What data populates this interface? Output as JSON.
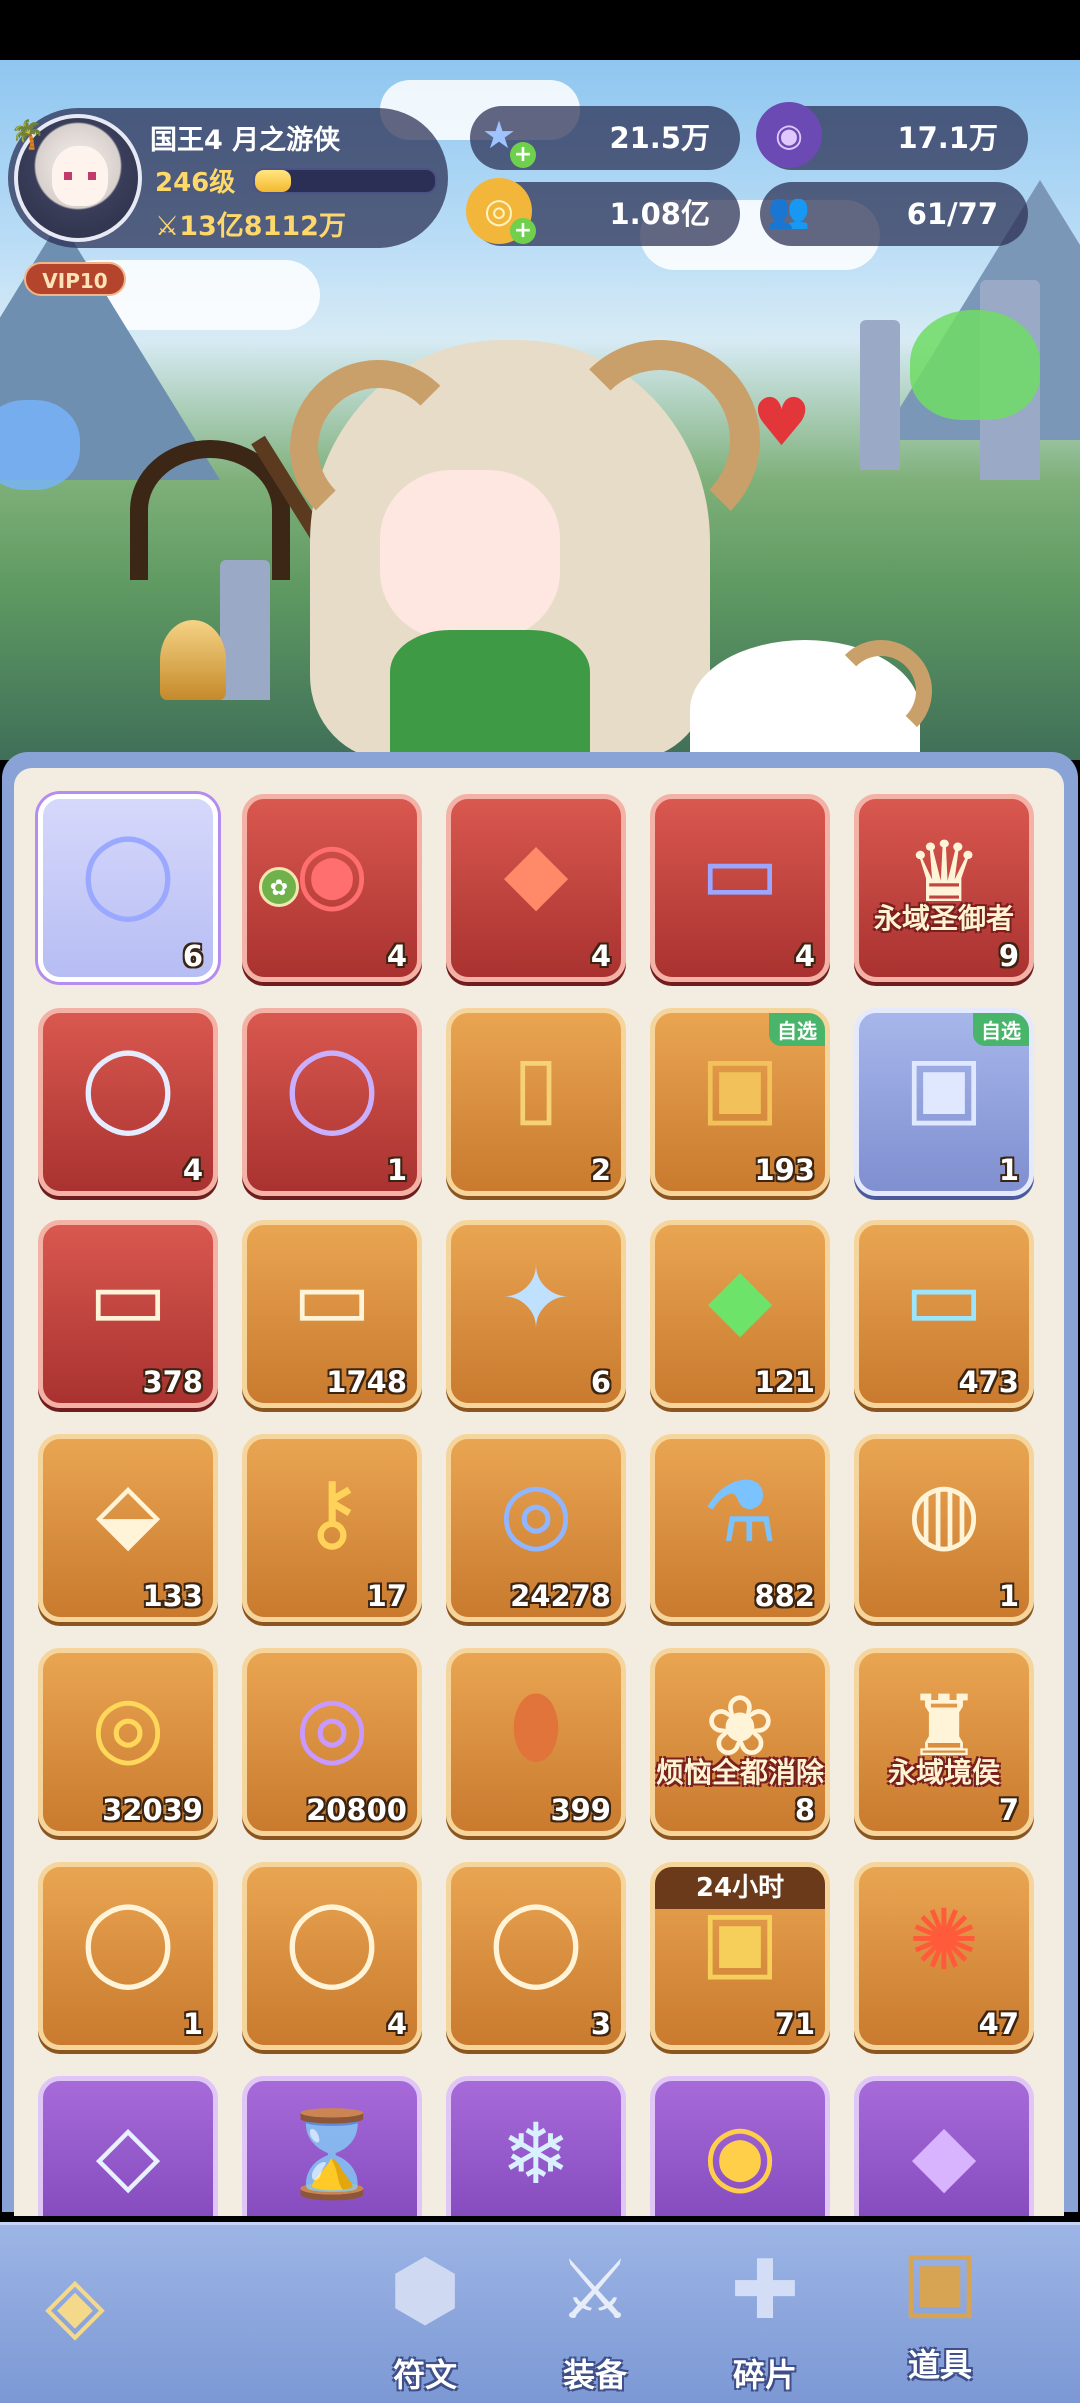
{
  "profile": {
    "name": "国王4 月之游侠",
    "level": "246级",
    "level_progress": 0.2,
    "power": "13亿8112万",
    "vip": "VIP10"
  },
  "resources": [
    {
      "icon": "star-gem-icon",
      "value": "21.5万",
      "add": true
    },
    {
      "icon": "purple-gem-icon",
      "value": "17.1万",
      "add": false
    },
    {
      "icon": "gold-coin-icon",
      "value": "1.08亿",
      "add": true
    },
    {
      "icon": "people-icon",
      "value": "61/77",
      "add": false
    }
  ],
  "items": [
    {
      "icon": "feather-ring-icon",
      "count": "6",
      "frame": "selected"
    },
    {
      "icon": "crystal-orb-icon",
      "count": "4",
      "frame": "red"
    },
    {
      "icon": "red-gem-icon",
      "count": "4",
      "frame": "red"
    },
    {
      "icon": "ticket-icon",
      "count": "4",
      "frame": "red"
    },
    {
      "icon": "crown-emblem-icon",
      "count": "9",
      "frame": "red",
      "caption": "永域圣御者"
    },
    {
      "icon": "silver-ring-icon",
      "count": "4",
      "frame": "red"
    },
    {
      "icon": "lion-ring-icon",
      "count": "1",
      "frame": "red"
    },
    {
      "icon": "card-icon",
      "count": "2",
      "frame": "orange"
    },
    {
      "icon": "treasure-chest-icon",
      "count": "193",
      "frame": "orange",
      "tag": "自选"
    },
    {
      "icon": "silver-chest-icon",
      "count": "1",
      "frame": "blue",
      "tag": "自选"
    },
    {
      "icon": "sun-ticket-icon",
      "count": "378",
      "frame": "red"
    },
    {
      "icon": "scroll-ticket-icon",
      "count": "1748",
      "frame": "orange"
    },
    {
      "icon": "star-crystal-icon",
      "count": "6",
      "frame": "orange"
    },
    {
      "icon": "green-crystal-icon",
      "count": "121",
      "frame": "orange"
    },
    {
      "icon": "heart-ticket-icon",
      "count": "473",
      "frame": "orange"
    },
    {
      "icon": "rainbow-crystal-icon",
      "count": "133",
      "frame": "orange"
    },
    {
      "icon": "golden-key-icon",
      "count": "17",
      "frame": "orange"
    },
    {
      "icon": "lock-coin-icon",
      "count": "24278",
      "frame": "orange"
    },
    {
      "icon": "potion-icon",
      "count": "882",
      "frame": "orange"
    },
    {
      "icon": "swirl-stone-icon",
      "count": "1",
      "frame": "orange"
    },
    {
      "icon": "gold-coin-icon",
      "count": "32039",
      "frame": "orange"
    },
    {
      "icon": "purple-coin-icon",
      "count": "20800",
      "frame": "orange"
    },
    {
      "icon": "dragon-egg-icon",
      "count": "399",
      "frame": "orange"
    },
    {
      "icon": "farm-scene-icon",
      "count": "8",
      "frame": "orange",
      "caption": "烦恼全都消除"
    },
    {
      "icon": "castle-emblem-icon",
      "count": "7",
      "frame": "orange",
      "caption": "永域境侯"
    },
    {
      "icon": "ring-8-icon",
      "count": "1",
      "frame": "orange"
    },
    {
      "icon": "ring-1-icon",
      "count": "4",
      "frame": "orange"
    },
    {
      "icon": "ring-4-icon",
      "count": "3",
      "frame": "orange"
    },
    {
      "icon": "gold-chest-icon",
      "count": "71",
      "frame": "orange",
      "topband": "24小时"
    },
    {
      "icon": "fire-orb-icon",
      "count": "47",
      "frame": "orange"
    },
    {
      "icon": "diamond-icon",
      "count": "",
      "frame": "purple"
    },
    {
      "icon": "hourglass-icon",
      "count": "",
      "frame": "purple"
    },
    {
      "icon": "ice-crystal-icon",
      "count": "",
      "frame": "purple"
    },
    {
      "icon": "planet-orb-icon",
      "count": "",
      "frame": "purple"
    },
    {
      "icon": "purple-gem-icon",
      "count": "",
      "frame": "purple"
    }
  ],
  "nav": [
    {
      "icon": "rune-icon",
      "label": "符文"
    },
    {
      "icon": "crossed-swords-icon",
      "label": "装备"
    },
    {
      "icon": "puzzle-piece-icon",
      "label": "碎片"
    },
    {
      "icon": "treasure-chest-icon",
      "label": "道具",
      "active": true
    }
  ],
  "colors": {
    "red": "#a93230",
    "orange": "#c97a2e",
    "blue": "#7f8fd0",
    "purple": "#7b43b6"
  }
}
